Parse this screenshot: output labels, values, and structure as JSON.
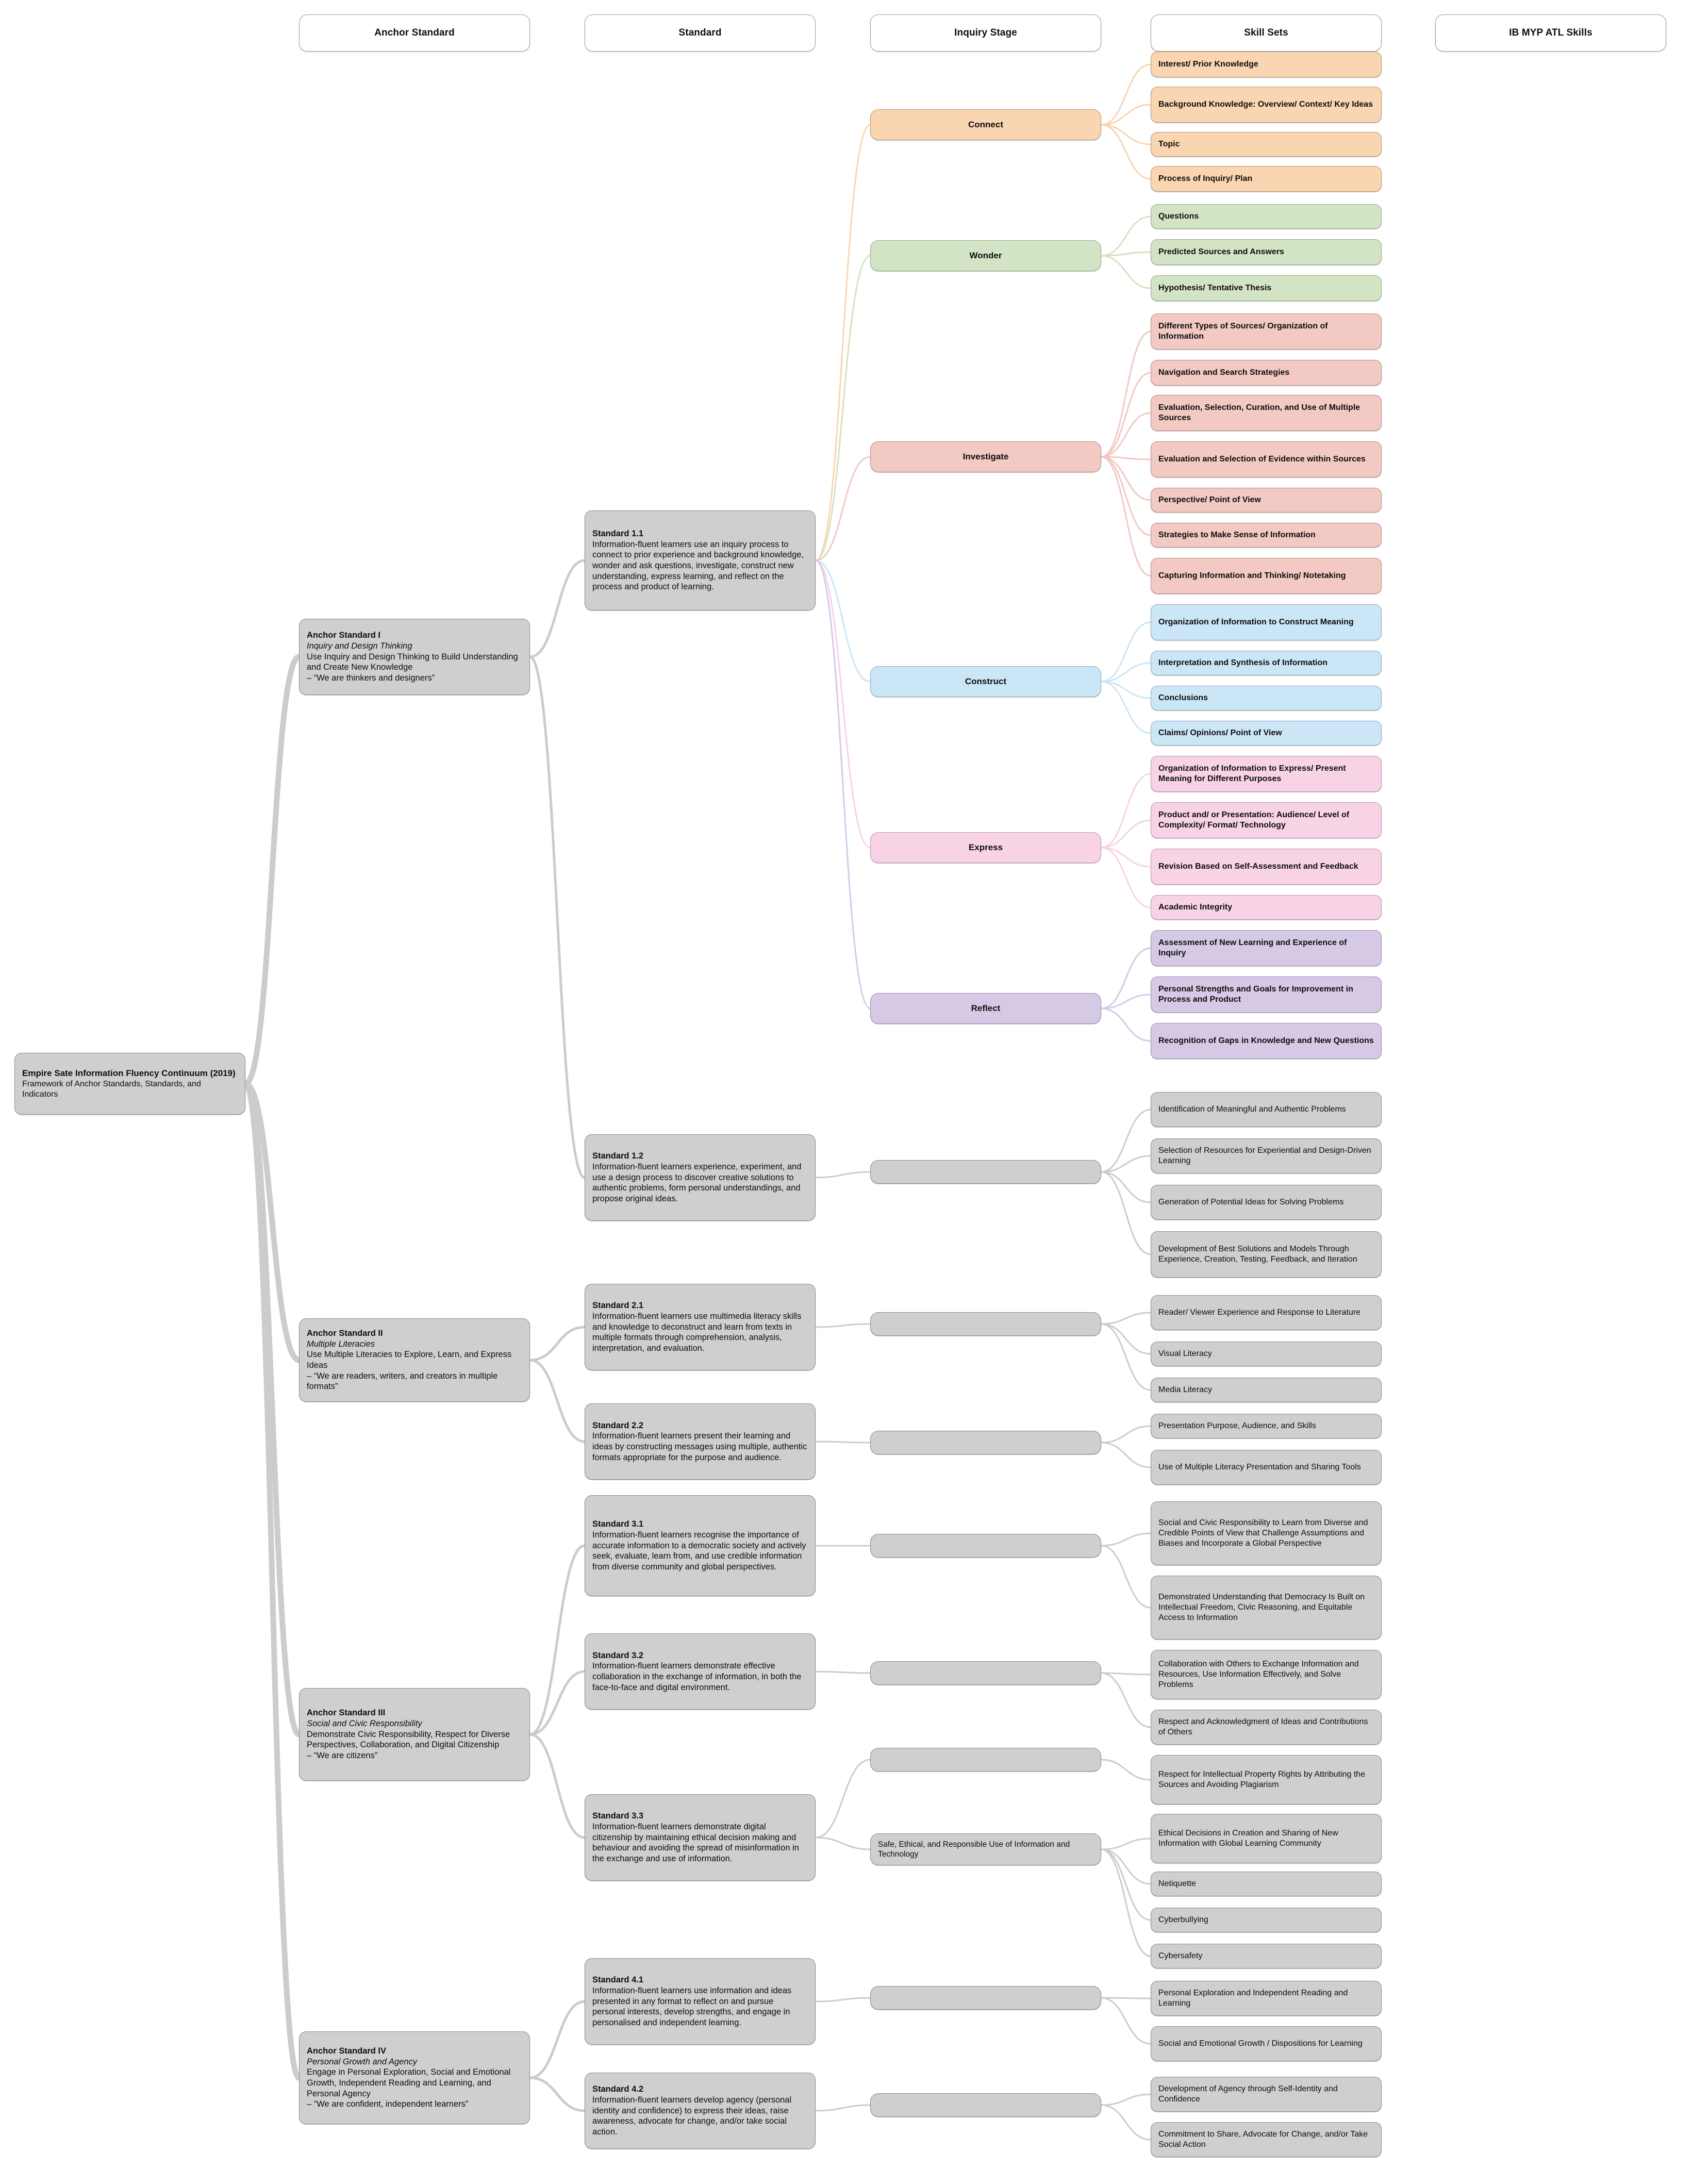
{
  "columns": [
    {
      "label": "Anchor Standard"
    },
    {
      "label": "Standard"
    },
    {
      "label": "Inquiry Stage"
    },
    {
      "label": "Skill Sets"
    },
    {
      "label": "IB MYP ATL Skills"
    }
  ],
  "root": {
    "title": "Empire Sate Information Fluency Continuum (2019)",
    "subtitle": "Framework of Anchor Standards, Standards, and Indicators"
  },
  "anchor_standards": [
    {
      "head": "Anchor Standard I",
      "italic": "Inquiry and Design Thinking",
      "body": "Use Inquiry and Design Thinking to Build Understanding and Create New Knowledge",
      "motto": "– “We are thinkers and designers”"
    },
    {
      "head": "Anchor Standard II",
      "italic": "Multiple Literacies",
      "body": "Use Multiple Literacies to Explore, Learn, and Express Ideas",
      "motto": "– “We are readers, writers, and creators in multiple formats”"
    },
    {
      "head": "Anchor Standard III",
      "italic": "Social and Civic Responsibility",
      "body": "Demonstrate Civic Responsibility, Respect for Diverse Perspectives, Collaboration, and Digital Citizenship",
      "motto": "– “We are citizens”"
    },
    {
      "head": "Anchor Standard IV",
      "italic": "Personal Growth and Agency",
      "body": "Engage in Personal Exploration, Social and Emotional Growth, Independent Reading and Learning, and Personal Agency",
      "motto": "– “We are confident, independent learners”"
    }
  ],
  "standards": [
    {
      "head": "Standard 1.1",
      "body": "Information-fluent learners use an inquiry process to connect to prior experience and background knowledge, wonder and ask questions, investigate, construct new understanding, express learning, and reflect on the process and product of learning."
    },
    {
      "head": "Standard 1.2",
      "body": "Information-fluent learners experience, experiment, and use a design process to discover creative solutions to authentic problems, form personal understandings, and propose original ideas."
    },
    {
      "head": "Standard 2.1",
      "body": "Information-fluent learners use multimedia literacy skills and knowledge to deconstruct and learn from texts in multiple formats through comprehension, analysis, interpretation, and evaluation."
    },
    {
      "head": "Standard 2.2",
      "body": "Information-fluent learners present their learning and ideas by constructing messages using multiple, authentic formats appropriate for the purpose and audience."
    },
    {
      "head": "Standard 3.1",
      "body": "Information-fluent learners recognise the importance of accurate information to a democratic society and actively seek, evaluate, learn from, and use credible information from diverse community and global perspectives."
    },
    {
      "head": "Standard 3.2",
      "body": "Information-fluent learners demonstrate effective collaboration in the exchange of information, in both the face-to-face and digital environment."
    },
    {
      "head": "Standard 3.3",
      "body": "Information-fluent learners demonstrate digital citizenship by maintaining ethical decision making and behaviour and avoiding the spread of misinformation in the exchange and use of information."
    },
    {
      "head": "Standard 4.1",
      "body": "Information-fluent learners use information and ideas presented in any format to reflect on and pursue personal interests, develop strengths, and engage in personalised and independent learning."
    },
    {
      "head": "Standard 4.2",
      "body": "Information-fluent learners develop agency (personal identity and confidence) to express their ideas, raise awareness, advocate for change, and/or take social action."
    }
  ],
  "inquiry_stages": [
    {
      "label": "Connect",
      "color": "#fad5b1"
    },
    {
      "label": "Wonder",
      "color": "#d3e4c4"
    },
    {
      "label": "Investigate",
      "color": "#f2c9c3"
    },
    {
      "label": "Construct",
      "color": "#cbe6f7"
    },
    {
      "label": "Express",
      "color": "#f7d3e5"
    },
    {
      "label": "Reflect",
      "color": "#d6c9e6"
    },
    {
      "label": "",
      "color": "#cfcfcf"
    },
    {
      "label": "",
      "color": "#cfcfcf"
    },
    {
      "label": "",
      "color": "#cfcfcf"
    },
    {
      "label": "",
      "color": "#cfcfcf"
    },
    {
      "label": "",
      "color": "#cfcfcf"
    },
    {
      "label": "",
      "color": "#cfcfcf"
    },
    {
      "label": "",
      "color": "#cfcfcf"
    },
    {
      "label": "Safe, Ethical, and Responsible Use of Information and Technology",
      "color": "#cfcfcf"
    },
    {
      "label": "",
      "color": "#cfcfcf"
    },
    {
      "label": "",
      "color": "#cfcfcf"
    }
  ],
  "skill_sets": [
    {
      "label": "Interest/ Prior Knowledge",
      "group": "connect"
    },
    {
      "label": "Background Knowledge: Overview/ Context/ Key Ideas",
      "group": "connect"
    },
    {
      "label": "Topic",
      "group": "connect"
    },
    {
      "label": "Process of Inquiry/ Plan",
      "group": "connect"
    },
    {
      "label": "Questions",
      "group": "wonder"
    },
    {
      "label": "Predicted Sources and Answers",
      "group": "wonder"
    },
    {
      "label": "Hypothesis/ Tentative Thesis",
      "group": "wonder"
    },
    {
      "label": "Different Types of Sources/ Organization of Information",
      "group": "investigate"
    },
    {
      "label": "Navigation and Search Strategies",
      "group": "investigate"
    },
    {
      "label": "Evaluation, Selection, Curation, and Use of Multiple Sources",
      "group": "investigate"
    },
    {
      "label": "Evaluation and Selection of Evidence within Sources",
      "group": "investigate"
    },
    {
      "label": "Perspective/ Point of View",
      "group": "investigate"
    },
    {
      "label": "Strategies to Make Sense of Information",
      "group": "investigate"
    },
    {
      "label": "Capturing Information and Thinking/ Notetaking",
      "group": "investigate"
    },
    {
      "label": "Organization of Information to Construct Meaning",
      "group": "construct"
    },
    {
      "label": "Interpretation and Synthesis of Information",
      "group": "construct"
    },
    {
      "label": "Conclusions",
      "group": "construct"
    },
    {
      "label": "Claims/ Opinions/ Point of View",
      "group": "construct"
    },
    {
      "label": "Organization of Information to Express/ Present Meaning for Different Purposes",
      "group": "express"
    },
    {
      "label": "Product and/ or Presentation: Audience/ Level of Complexity/ Format/ Technology",
      "group": "express"
    },
    {
      "label": "Revision Based on Self-Assessment and Feedback",
      "group": "express"
    },
    {
      "label": "Academic Integrity",
      "group": "express"
    },
    {
      "label": "Assessment of New Learning and Experience of Inquiry",
      "group": "reflect"
    },
    {
      "label": "Personal Strengths and Goals for Improvement in Process and Product",
      "group": "reflect"
    },
    {
      "label": "Recognition of Gaps in Knowledge and New Questions",
      "group": "reflect"
    },
    {
      "label": "Identification of Meaningful and Authentic Problems",
      "group": "gray"
    },
    {
      "label": "Selection of Resources for Experiential and Design-Driven Learning",
      "group": "gray"
    },
    {
      "label": "Generation of Potential Ideas for Solving Problems",
      "group": "gray"
    },
    {
      "label": "Development of Best Solutions and Models Through Experience, Creation, Testing, Feedback, and Iteration",
      "group": "gray"
    },
    {
      "label": "Reader/ Viewer Experience and Response to Literature",
      "group": "gray"
    },
    {
      "label": "Visual Literacy",
      "group": "gray"
    },
    {
      "label": "Media Literacy",
      "group": "gray"
    },
    {
      "label": "Presentation Purpose, Audience, and Skills",
      "group": "gray"
    },
    {
      "label": "Use of Multiple Literacy Presentation and Sharing Tools",
      "group": "gray"
    },
    {
      "label": "Social and Civic Responsibility to Learn from Diverse and Credible Points of View that Challenge Assumptions and Biases and Incorporate a Global Perspective",
      "group": "gray"
    },
    {
      "label": "Demonstrated Understanding that Democracy Is Built on Intellectual Freedom, Civic Reasoning, and Equitable Access to Information",
      "group": "gray"
    },
    {
      "label": "Collaboration with Others to Exchange Information and Resources, Use Information Effectively, and Solve Problems",
      "group": "gray"
    },
    {
      "label": "Respect and Acknowledgment of Ideas and Contributions of Others",
      "group": "gray"
    },
    {
      "label": "Respect for Intellectual Property Rights by Attributing the Sources and Avoiding Plagiarism",
      "group": "gray"
    },
    {
      "label": "Ethical Decisions in Creation and Sharing of New Information with Global Learning Community",
      "group": "gray"
    },
    {
      "label": "Netiquette",
      "group": "gray"
    },
    {
      "label": "Cyberbullying",
      "group": "gray"
    },
    {
      "label": "Cybersafety",
      "group": "gray"
    },
    {
      "label": "Personal Exploration and Independent Reading and Learning",
      "group": "gray"
    },
    {
      "label": "Social and Emotional Growth / Dispositions for Learning",
      "group": "gray"
    },
    {
      "label": "Development of Agency through Self-Identity and Confidence",
      "group": "gray"
    },
    {
      "label": "Commitment to Share, Advocate for Change, and/or Take Social Action",
      "group": "gray"
    }
  ],
  "palette": {
    "connect": "#fad5b1",
    "wonder": "#d3e4c4",
    "investigate": "#f2c9c3",
    "construct": "#cbe6f7",
    "express": "#f7d3e5",
    "reflect": "#d6c9e6",
    "gray": "#cfcfcf"
  }
}
